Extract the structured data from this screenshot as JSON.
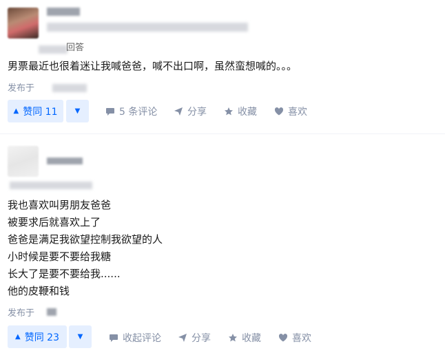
{
  "answers": [
    {
      "reply_label": "回答",
      "content_lines": [
        "男票最近也很着迷让我喊爸爸，喊不出口啊，虽然蛮想喊的。。。"
      ],
      "published_prefix": "发布于",
      "upvote_label": "赞同 11",
      "comments_label": "5 条评论",
      "share_label": "分享",
      "favorite_label": "收藏",
      "like_label": "喜欢"
    },
    {
      "content_lines": [
        "我也喜欢叫男朋友爸爸",
        "被要求后就喜欢上了",
        "爸爸是满足我欲望控制我欲望的人",
        "小时候是要不要给我糖",
        "长大了是要不要给我......",
        "他的皮鞭和钱"
      ],
      "published_prefix": "发布于",
      "upvote_label": "赞同 23",
      "comments_label": "收起评论",
      "share_label": "分享",
      "favorite_label": "收藏",
      "like_label": "喜欢"
    }
  ],
  "colors": {
    "accent": "#0066ff",
    "accent_bg": "#e5efff",
    "meta": "#8590a6"
  },
  "icons": [
    "comment-icon",
    "share-icon",
    "star-icon",
    "heart-icon",
    "upvote-triangle-icon",
    "downvote-triangle-icon"
  ]
}
